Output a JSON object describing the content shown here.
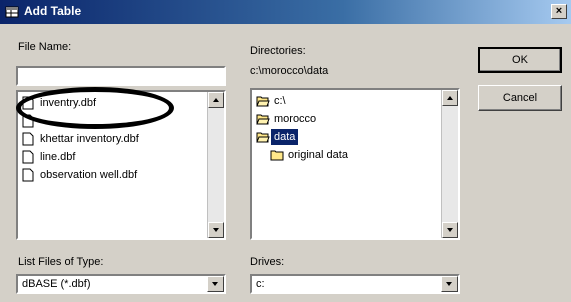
{
  "window": {
    "title": "Add Table",
    "close_glyph": "×"
  },
  "file_name": {
    "label": "File Name:",
    "value": ""
  },
  "file_list": {
    "items": [
      {
        "label": "inventry.dbf",
        "icon": "document-icon"
      },
      {
        "label": "",
        "icon": "document-icon"
      },
      {
        "label": "khettar inventory.dbf",
        "icon": "document-icon"
      },
      {
        "label": "line.dbf",
        "icon": "document-icon"
      },
      {
        "label": "observation well.dbf",
        "icon": "document-icon"
      }
    ]
  },
  "directories": {
    "label": "Directories:",
    "current_path": "c:\\morocco\\data",
    "items": [
      {
        "label": "c:\\",
        "icon": "open-folder-icon",
        "selected": false
      },
      {
        "label": "morocco",
        "icon": "open-folder-icon",
        "selected": false
      },
      {
        "label": "data",
        "icon": "open-folder-icon",
        "selected": true
      },
      {
        "label": "original data",
        "icon": "folder-icon",
        "selected": false
      }
    ]
  },
  "buttons": {
    "ok": "OK",
    "cancel": "Cancel"
  },
  "file_type": {
    "label": "List Files of Type:",
    "value": "dBASE (*.dbf)"
  },
  "drives": {
    "label": "Drives:",
    "value": "c:"
  },
  "colors": {
    "selection": "#0a246a",
    "dialog_bg": "#d4d0c8",
    "annotation": "#000000"
  }
}
